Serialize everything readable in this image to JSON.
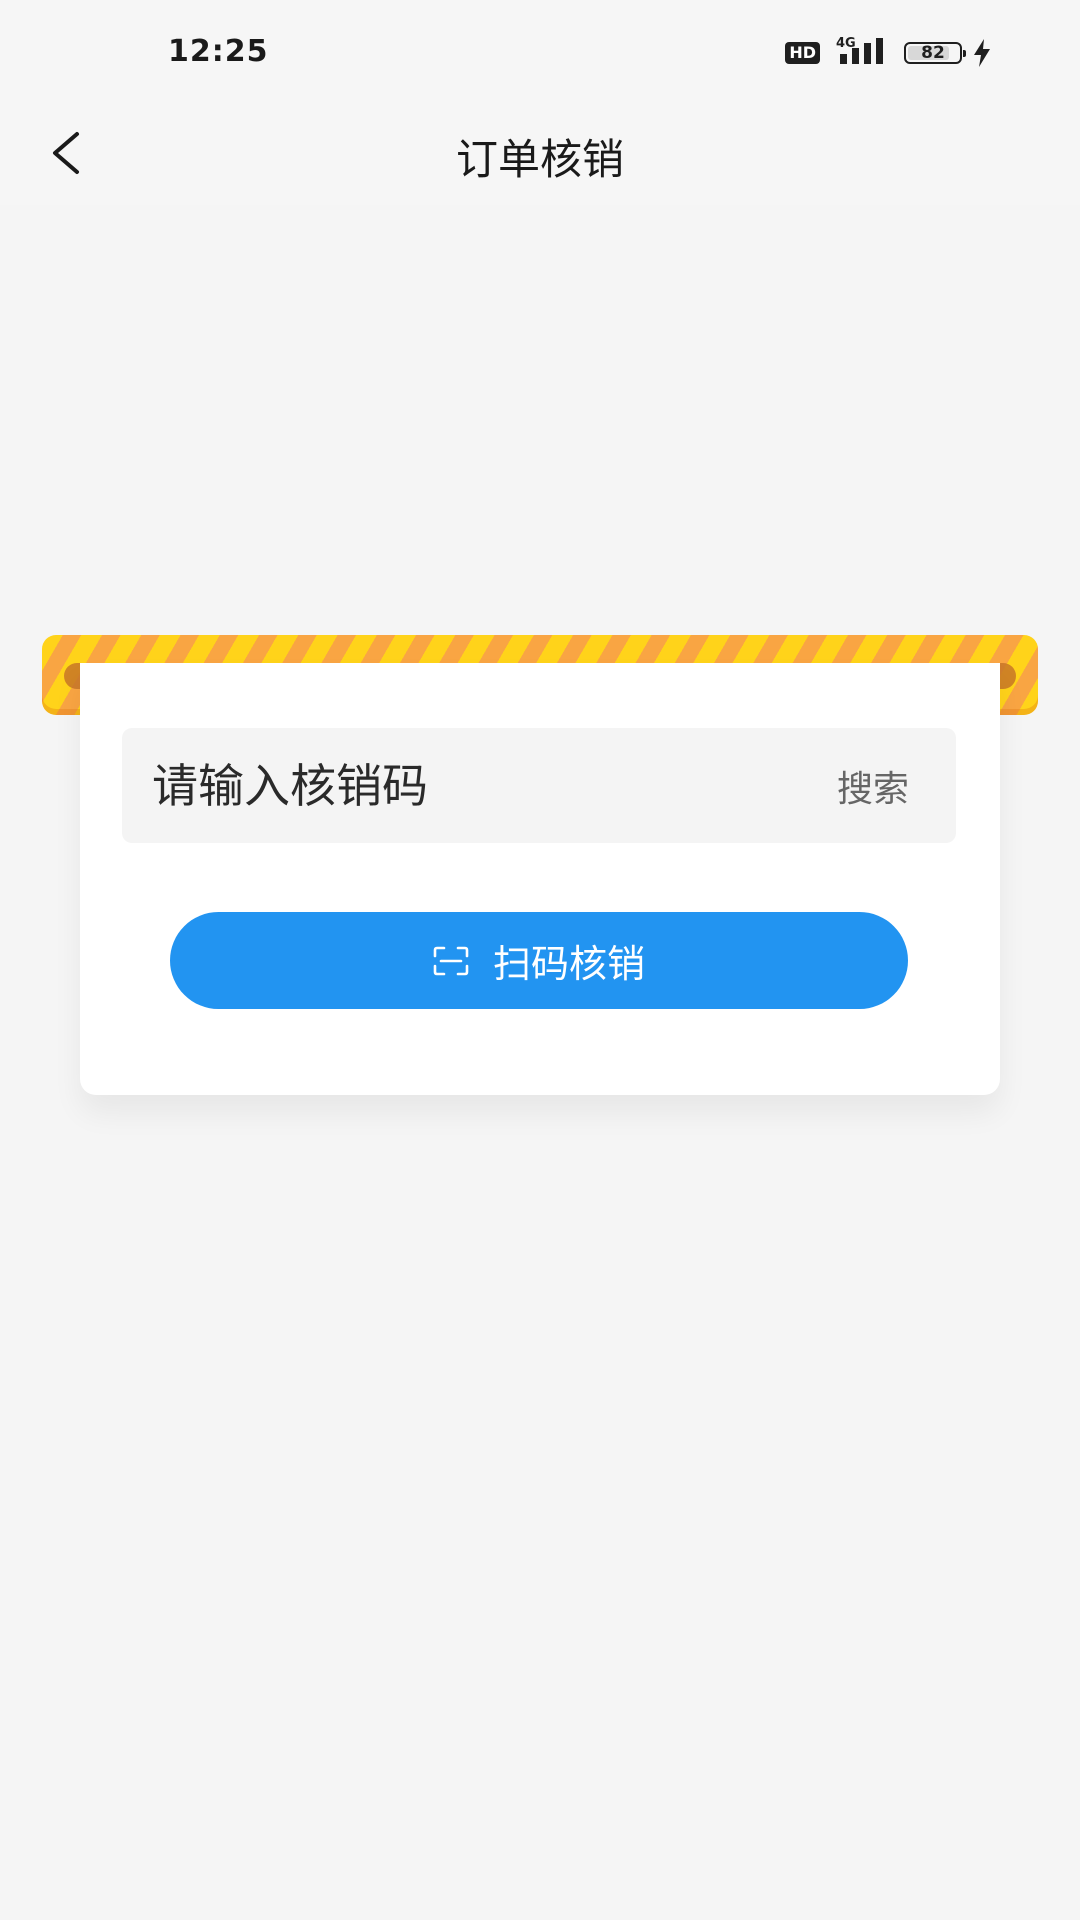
{
  "status_bar": {
    "time": "12:25",
    "hd": "HD",
    "network": "4G",
    "battery": "82",
    "battery_level": 0.82
  },
  "nav": {
    "title": "订单核销",
    "back_icon": "chevron-left-icon"
  },
  "verify": {
    "input_placeholder": "请输入核销码",
    "input_value": "",
    "search_label": "搜索",
    "scan_label": "扫码核销",
    "scan_icon": "scan-icon"
  },
  "colors": {
    "primary": "#2294f1",
    "stripe_yellow": "#ffd31a",
    "stripe_orange": "#f9a543",
    "background": "#f5f5f5"
  }
}
